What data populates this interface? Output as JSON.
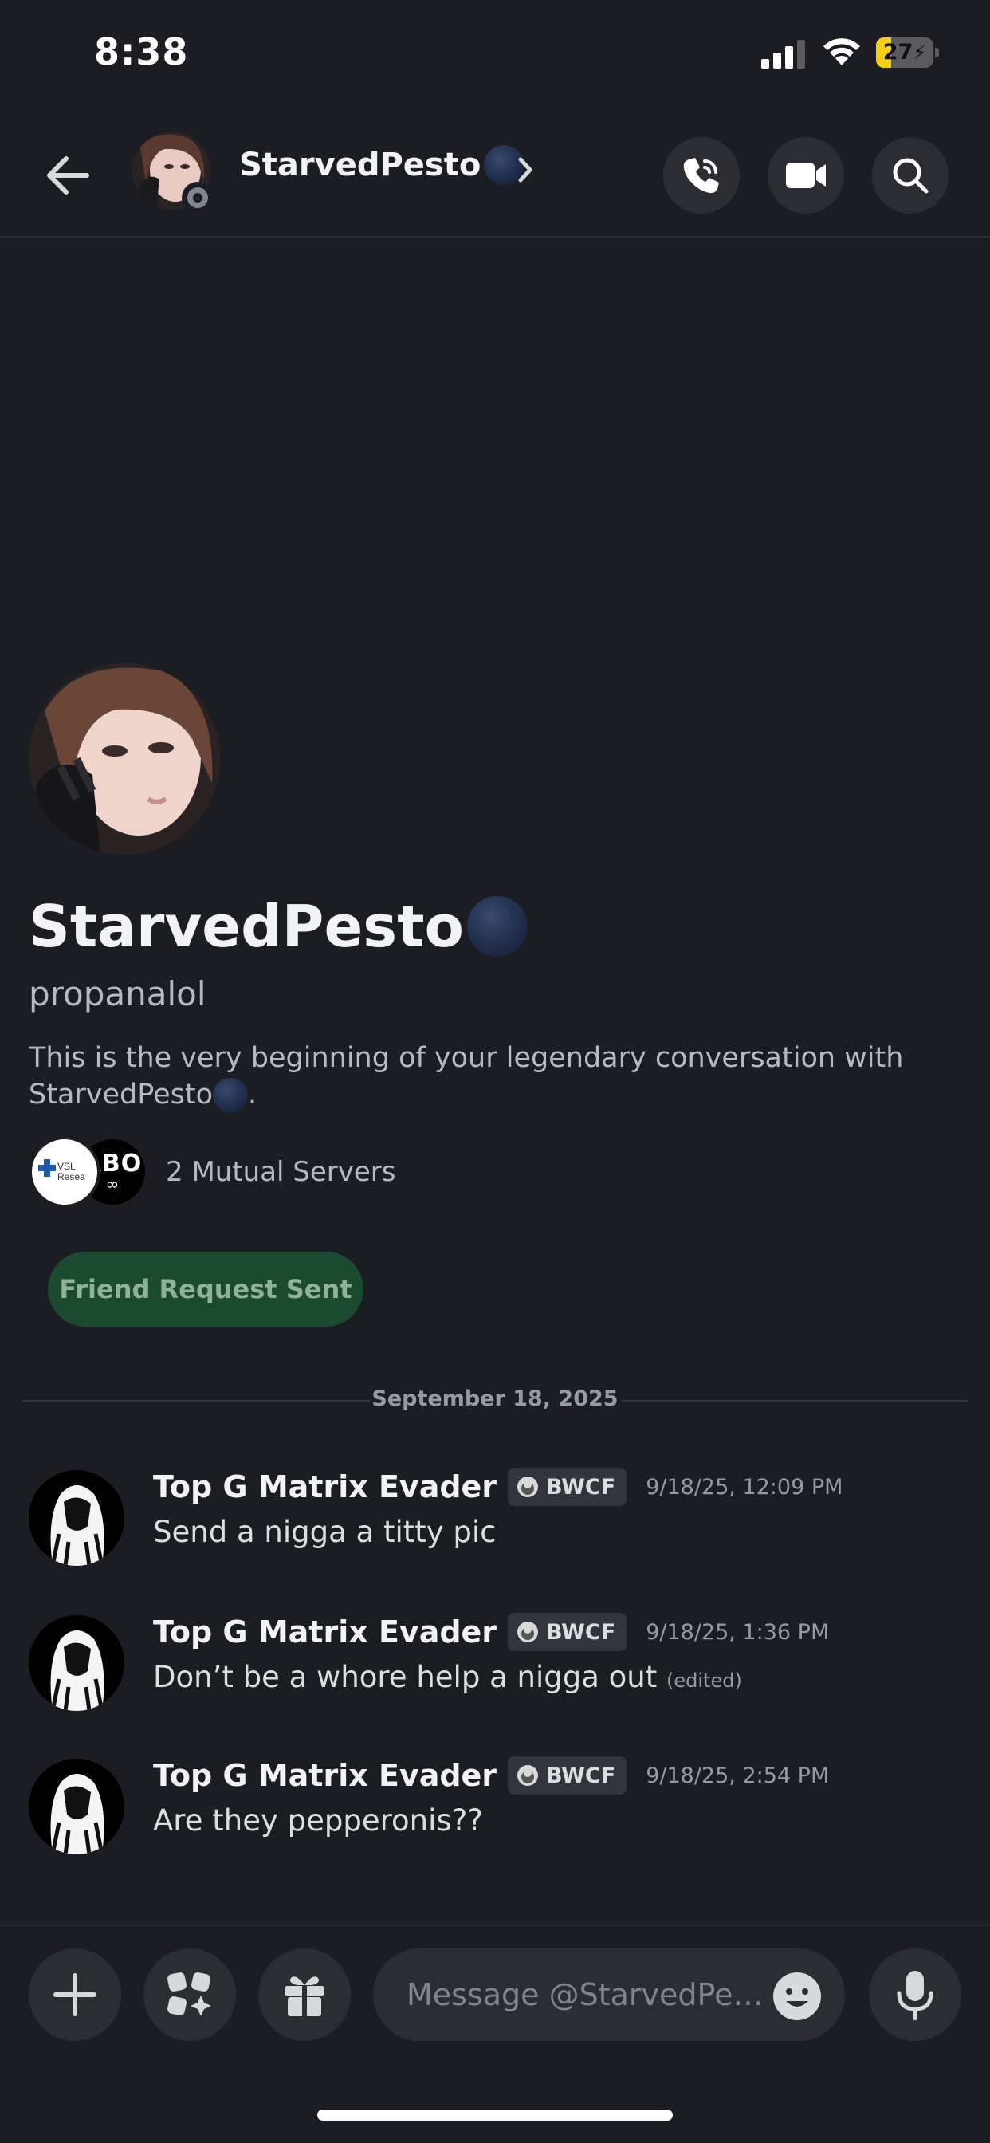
{
  "status_bar": {
    "time": "8:38",
    "battery_level": "27",
    "battery_fraction": 0.27
  },
  "header": {
    "name": "StarvedPesto",
    "icons": [
      "back-arrow-icon",
      "voice-call-icon",
      "video-call-icon",
      "search-icon",
      "chevron-right-icon"
    ]
  },
  "profile": {
    "display_name": "StarvedPesto",
    "username": "propanalol",
    "intro_prefix": "This is the very beginning of your legendary conversation with StarvedPesto",
    "intro_suffix": ".",
    "mutual_servers": "2 Mutual Servers",
    "server_1_text": "VSL Resea",
    "server_2_text": "ABO",
    "server_2_sub": "∞",
    "friend_button": "Friend Request Sent"
  },
  "divider": {
    "date": "September 18, 2025"
  },
  "messages": [
    {
      "author": "Top G Matrix Evader",
      "tag": "BWCF",
      "timestamp": "9/18/25, 12:09 PM",
      "text": "Send a nigga a titty pic",
      "edited": ""
    },
    {
      "author": "Top G Matrix Evader",
      "tag": "BWCF",
      "timestamp": "9/18/25, 1:36 PM",
      "text": "Don’t be a whore help a nigga out",
      "edited": "(edited)"
    },
    {
      "author": "Top G Matrix Evader",
      "tag": "BWCF",
      "timestamp": "9/18/25, 2:54 PM",
      "text": "Are they pepperonis??",
      "edited": ""
    }
  ],
  "composer": {
    "placeholder": "Message @StarvedPe…",
    "icons": [
      "plus-icon",
      "apps-icon",
      "gift-icon",
      "emoji-icon",
      "microphone-icon"
    ]
  },
  "colors": {
    "background": "#1c1d23",
    "button_bg": "#2b2d33",
    "friend_button_bg": "#1c4a30",
    "battery_fill": "#f6cf15"
  }
}
